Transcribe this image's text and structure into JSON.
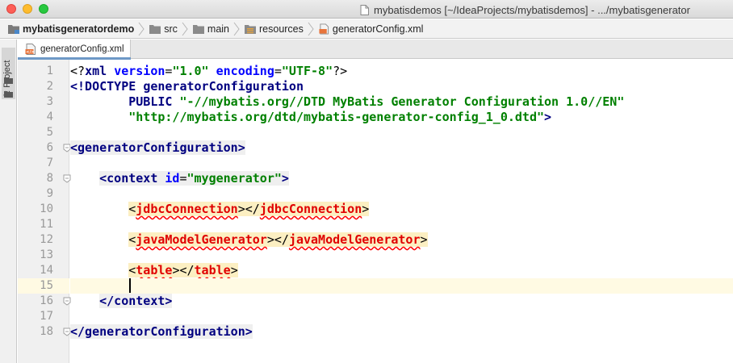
{
  "window": {
    "title": "mybatisdemos [~/IdeaProjects/mybatisdemos] - .../mybatisgenerator"
  },
  "breadcrumbs": [
    {
      "label": "mybatisgeneratordemo",
      "icon": "module-folder-icon",
      "bold": true
    },
    {
      "label": "src",
      "icon": "folder-icon",
      "bold": false
    },
    {
      "label": "main",
      "icon": "folder-icon",
      "bold": false
    },
    {
      "label": "resources",
      "icon": "resources-folder-icon",
      "bold": false
    },
    {
      "label": "generatorConfig.xml",
      "icon": "xml-file-icon",
      "bold": false
    }
  ],
  "tool_window": {
    "project_label": "1: Project"
  },
  "editor_tab": {
    "label": "generatorConfig.xml",
    "icon": "xml-file-icon"
  },
  "colors": {
    "close": "#fd5f57",
    "minimize": "#febc2e",
    "maximize": "#28c840",
    "accent_tab_underline": "#6e99c7",
    "current_line": "#fffae3",
    "tag_name": "#000080",
    "string": "#008000",
    "error": "#e00000"
  },
  "editor": {
    "current_line": 15,
    "caret_line": 15,
    "lines": [
      {
        "n": "1",
        "fold": false,
        "tokens": [
          {
            "t": "<?",
            "c": "t-txt"
          },
          {
            "t": "xml ",
            "c": "t-kw"
          },
          {
            "t": "version",
            "c": "t-attr"
          },
          {
            "t": "=",
            "c": "t-plain"
          },
          {
            "t": "\"1.0\"",
            "c": "t-str"
          },
          {
            "t": " ",
            "c": "t-plain"
          },
          {
            "t": "encoding",
            "c": "t-attr"
          },
          {
            "t": "=",
            "c": "t-plain"
          },
          {
            "t": "\"UTF-8\"",
            "c": "t-str"
          },
          {
            "t": "?>",
            "c": "t-txt"
          }
        ]
      },
      {
        "n": "2",
        "fold": false,
        "tokens": [
          {
            "t": "<!DOCTYPE ",
            "c": "t-kw"
          },
          {
            "t": "generatorConfiguration",
            "c": "t-kw"
          }
        ]
      },
      {
        "n": "3",
        "fold": false,
        "tokens": [
          {
            "t": "        PUBLIC ",
            "c": "t-kw"
          },
          {
            "t": "\"-//mybatis.org//DTD MyBatis Generator Configuration 1.0//EN\"",
            "c": "t-str"
          }
        ]
      },
      {
        "n": "4",
        "fold": false,
        "tokens": [
          {
            "t": "        ",
            "c": "t-plain"
          },
          {
            "t": "\"http://mybatis.org/dtd/mybatis-generator-config_1_0.dtd\"",
            "c": "t-str"
          },
          {
            "t": ">",
            "c": "t-kw"
          }
        ]
      },
      {
        "n": "5",
        "fold": false,
        "tokens": []
      },
      {
        "n": "6",
        "fold": true,
        "tokens": [
          {
            "t": "<generatorConfiguration>",
            "c": "t-tag t-tagbg"
          }
        ]
      },
      {
        "n": "7",
        "fold": false,
        "tokens": []
      },
      {
        "n": "8",
        "fold": true,
        "tokens": [
          {
            "t": "    ",
            "c": "t-plain"
          },
          {
            "t": "<context ",
            "c": "t-tag t-tagbg"
          },
          {
            "t": "id",
            "c": "t-attr t-tagbg"
          },
          {
            "t": "=",
            "c": "t-plain t-tagbg"
          },
          {
            "t": "\"mygenerator\"",
            "c": "t-str t-tagbg"
          },
          {
            "t": ">",
            "c": "t-tag t-tagbg"
          }
        ]
      },
      {
        "n": "9",
        "fold": false,
        "tokens": []
      },
      {
        "n": "10",
        "fold": false,
        "tokens": [
          {
            "t": "        ",
            "c": "t-plain"
          },
          {
            "t": "<",
            "c": "t-errb"
          },
          {
            "t": "jdbcConnection",
            "c": "t-err"
          },
          {
            "t": "></",
            "c": "t-errb"
          },
          {
            "t": "jdbcConnection",
            "c": "t-err"
          },
          {
            "t": ">",
            "c": "t-errb"
          }
        ]
      },
      {
        "n": "11",
        "fold": false,
        "tokens": []
      },
      {
        "n": "12",
        "fold": false,
        "tokens": [
          {
            "t": "        ",
            "c": "t-plain"
          },
          {
            "t": "<",
            "c": "t-errb"
          },
          {
            "t": "javaModelGenerator",
            "c": "t-err"
          },
          {
            "t": "></",
            "c": "t-errb"
          },
          {
            "t": "javaModelGenerator",
            "c": "t-err"
          },
          {
            "t": ">",
            "c": "t-errb"
          }
        ]
      },
      {
        "n": "13",
        "fold": false,
        "tokens": []
      },
      {
        "n": "14",
        "fold": false,
        "tokens": [
          {
            "t": "        ",
            "c": "t-plain"
          },
          {
            "t": "<",
            "c": "t-errb"
          },
          {
            "t": "table",
            "c": "t-err"
          },
          {
            "t": "></",
            "c": "t-errb"
          },
          {
            "t": "table",
            "c": "t-err"
          },
          {
            "t": ">",
            "c": "t-errb"
          }
        ]
      },
      {
        "n": "15",
        "fold": false,
        "tokens": []
      },
      {
        "n": "16",
        "fold": true,
        "tokens": [
          {
            "t": "    ",
            "c": "t-plain"
          },
          {
            "t": "</context>",
            "c": "t-tag t-tagbg"
          }
        ]
      },
      {
        "n": "17",
        "fold": false,
        "tokens": []
      },
      {
        "n": "18",
        "fold": true,
        "tokens": [
          {
            "t": "</generatorConfiguration>",
            "c": "t-tag t-tagbg"
          }
        ]
      }
    ]
  }
}
